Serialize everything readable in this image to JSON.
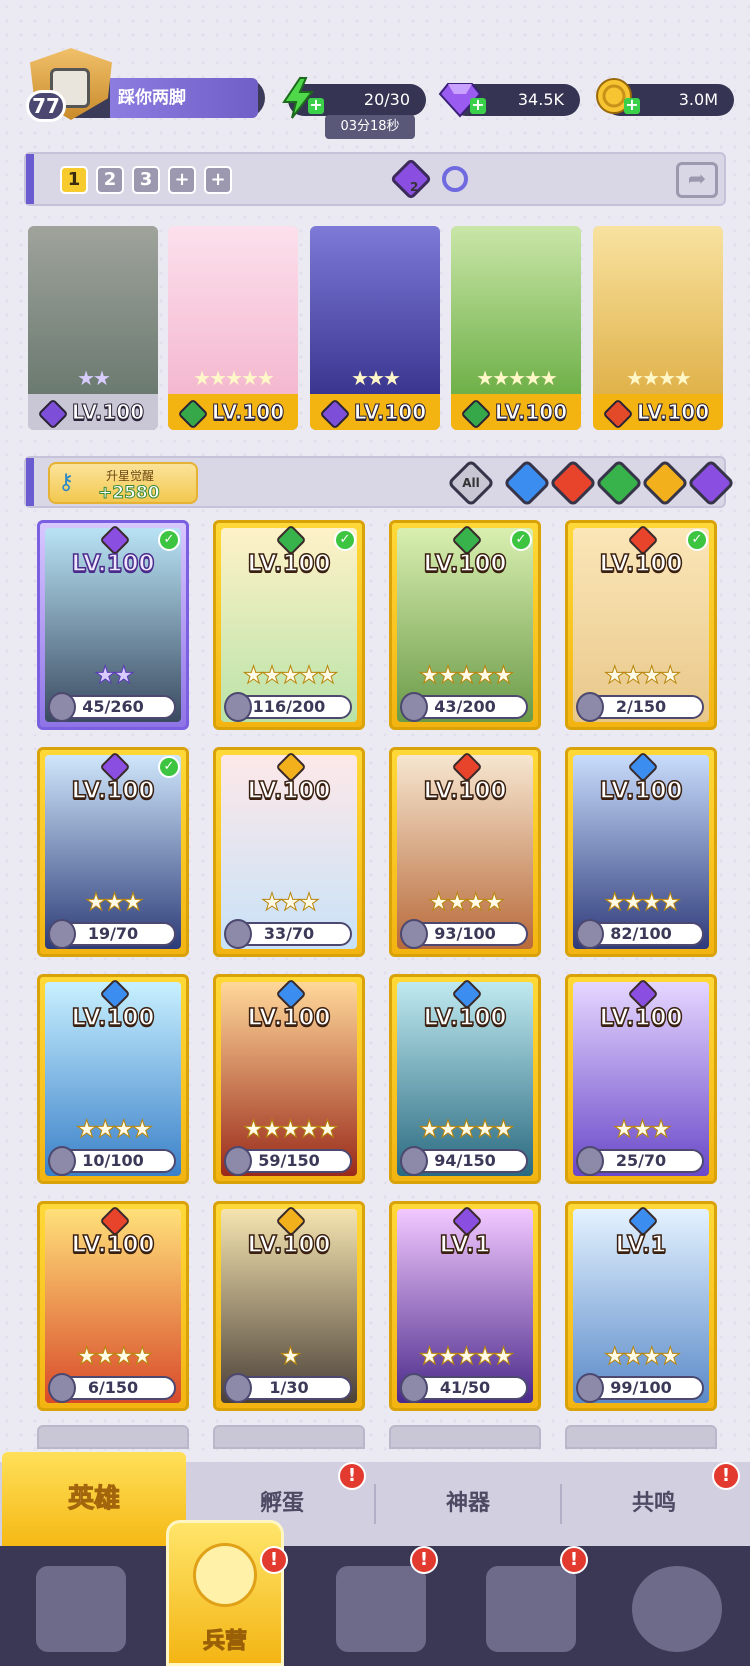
{
  "player": {
    "level": "77",
    "name": "踩你两脚"
  },
  "resources": {
    "energy": {
      "value": "20/30",
      "timer": "03分18秒",
      "icon": "lightning-icon"
    },
    "gems": {
      "value": "34.5K",
      "icon": "diamond-icon"
    },
    "coins": {
      "value": "3.0M",
      "icon": "coin-icon"
    }
  },
  "team_bar": {
    "tabs": [
      "1",
      "2",
      "3",
      "+",
      "+"
    ],
    "active_tab": "1",
    "element_count": "2"
  },
  "team": [
    {
      "level": "LV.100",
      "stars": "★★",
      "element": "dark",
      "color": "#7d4fd8"
    },
    {
      "level": "LV.100",
      "stars": "★★★★★",
      "element": "nature",
      "color": "#36a84a"
    },
    {
      "level": "LV.100",
      "stars": "★★★",
      "element": "dark",
      "color": "#7d4fd8"
    },
    {
      "level": "LV.100",
      "stars": "★★★★★",
      "element": "nature",
      "color": "#36a84a"
    },
    {
      "level": "LV.100",
      "stars": "★★★★",
      "element": "fire",
      "color": "#e24a2a"
    }
  ],
  "key_bar": {
    "label": "升星觉醒",
    "value": "+2580",
    "filter_all": "All"
  },
  "filters": [
    {
      "name": "water",
      "color": "#3b8ef0"
    },
    {
      "name": "fire",
      "color": "#e8432b"
    },
    {
      "name": "nature",
      "color": "#38b24a"
    },
    {
      "name": "light",
      "color": "#f2b01c"
    },
    {
      "name": "dark",
      "color": "#8a4ee0"
    }
  ],
  "heroes": [
    {
      "level": "LV.100",
      "progress": "45/260",
      "stars": "★★",
      "element": "#8a4ee0",
      "checked": true,
      "purple": true
    },
    {
      "level": "LV.100",
      "progress": "116/200",
      "stars": "★★★★★",
      "element": "#38b24a",
      "checked": true
    },
    {
      "level": "LV.100",
      "progress": "43/200",
      "stars": "★★★★★",
      "element": "#38b24a",
      "checked": true
    },
    {
      "level": "LV.100",
      "progress": "2/150",
      "stars": "★★★★",
      "element": "#e8432b",
      "checked": true
    },
    {
      "level": "LV.100",
      "progress": "19/70",
      "stars": "★★★",
      "element": "#8a4ee0",
      "checked": true
    },
    {
      "level": "LV.100",
      "progress": "33/70",
      "stars": "★★★",
      "element": "#f2b01c"
    },
    {
      "level": "LV.100",
      "progress": "93/100",
      "stars": "★★★★",
      "element": "#e8432b"
    },
    {
      "level": "LV.100",
      "progress": "82/100",
      "stars": "★★★★",
      "element": "#3b8ef0"
    },
    {
      "level": "LV.100",
      "progress": "10/100",
      "stars": "★★★★",
      "element": "#3b8ef0"
    },
    {
      "level": "LV.100",
      "progress": "59/150",
      "stars": "★★★★★",
      "element": "#3b8ef0"
    },
    {
      "level": "LV.100",
      "progress": "94/150",
      "stars": "★★★★★",
      "element": "#3b8ef0"
    },
    {
      "level": "LV.100",
      "progress": "25/70",
      "stars": "★★★",
      "element": "#8a4ee0"
    },
    {
      "level": "LV.100",
      "progress": "6/150",
      "stars": "★★★★",
      "element": "#e8432b"
    },
    {
      "level": "LV.100",
      "progress": "1/30",
      "stars": "★",
      "element": "#f2b01c"
    },
    {
      "level": "LV.1",
      "progress": "41/50",
      "stars": "★★★★★",
      "element": "#8a4ee0"
    },
    {
      "level": "LV.1",
      "progress": "99/100",
      "stars": "★★★★",
      "element": "#3b8ef0"
    }
  ],
  "subtabs": [
    {
      "label": "英雄",
      "badge": false
    },
    {
      "label": "孵蛋",
      "badge": true
    },
    {
      "label": "神器",
      "badge": false
    },
    {
      "label": "共鸣",
      "badge": true
    }
  ],
  "nav": {
    "active_label": "兵营",
    "items": [
      "cards-icon",
      "barracks-icon",
      "book-icon",
      "temple-icon",
      "mushroom-icon"
    ]
  },
  "badge_mark": "!",
  "check_mark": "✓"
}
